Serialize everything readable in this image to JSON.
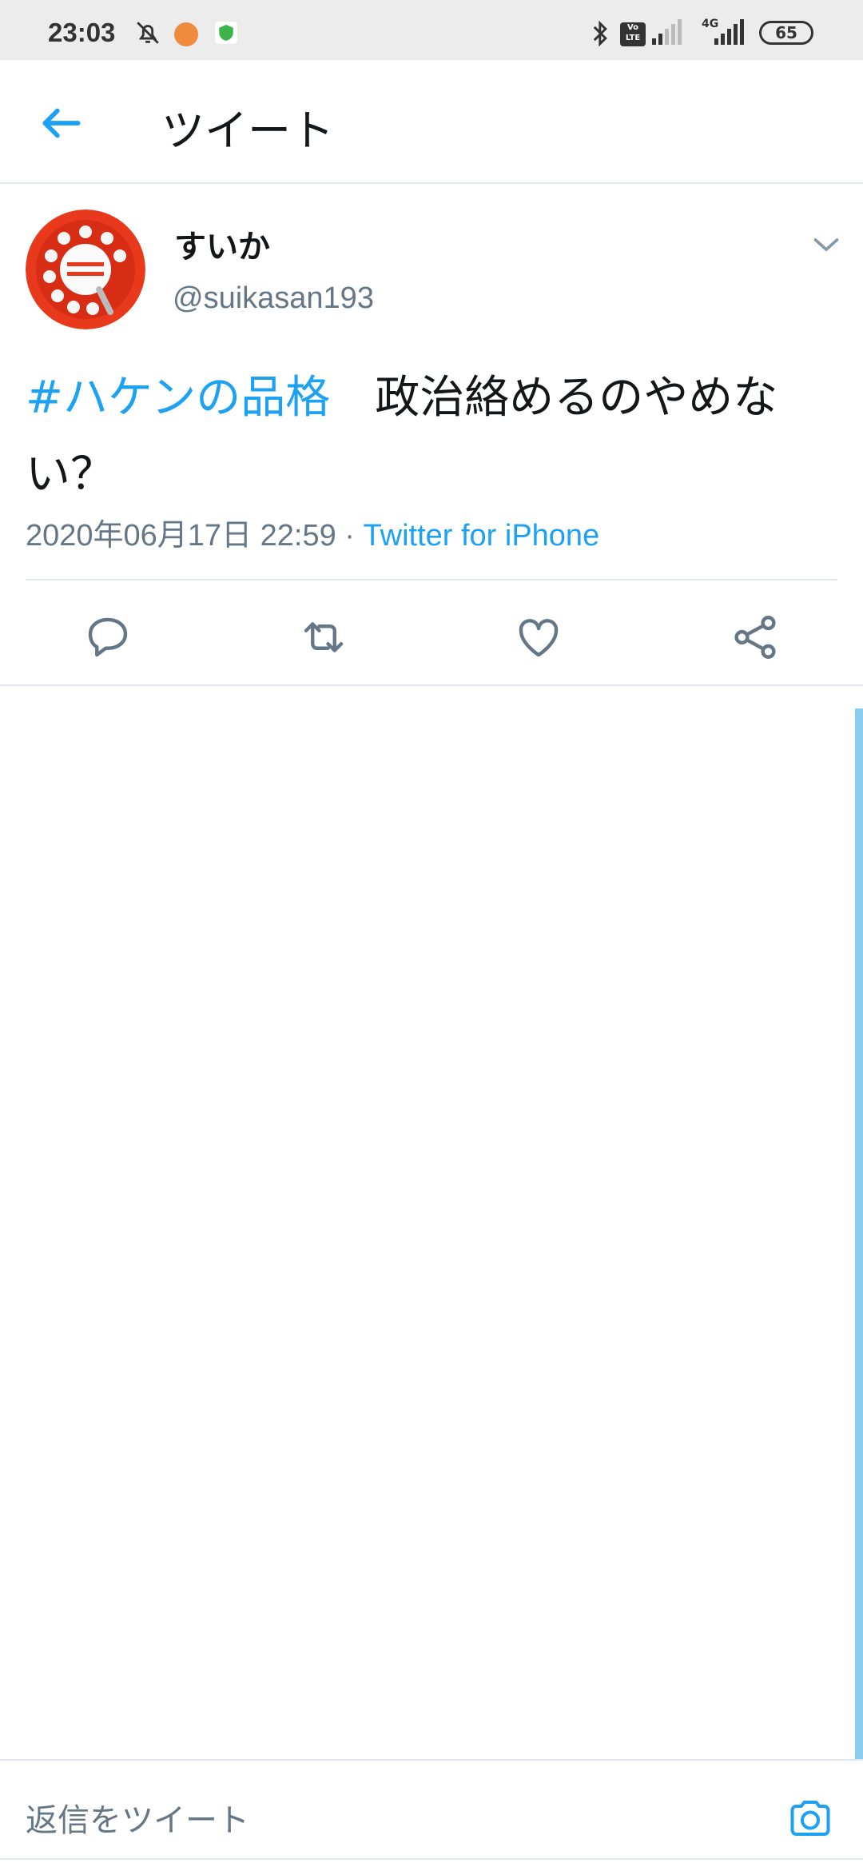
{
  "status_bar": {
    "time": "23:03",
    "network": "4G",
    "volte": "Vo LTE",
    "battery": "65"
  },
  "header": {
    "title": "ツイート"
  },
  "tweet": {
    "display_name": "すいか",
    "handle": "@suikasan193",
    "hashtag": "#ハケンの品格",
    "text": "　政治絡めるのやめない？",
    "timestamp": "2020年06月17日 22:59",
    "separator": " · ",
    "source": "Twitter for iPhone"
  },
  "actions": [
    {
      "name": "reply",
      "icon": "comment-icon"
    },
    {
      "name": "retweet",
      "icon": "retweet-icon"
    },
    {
      "name": "like",
      "icon": "heart-icon"
    },
    {
      "name": "share",
      "icon": "share-icon"
    }
  ],
  "reply_bar": {
    "placeholder": "返信をツイート"
  },
  "colors": {
    "accent": "#1da1f2",
    "secondary_text": "#657786",
    "divider": "#e1e8ed"
  }
}
